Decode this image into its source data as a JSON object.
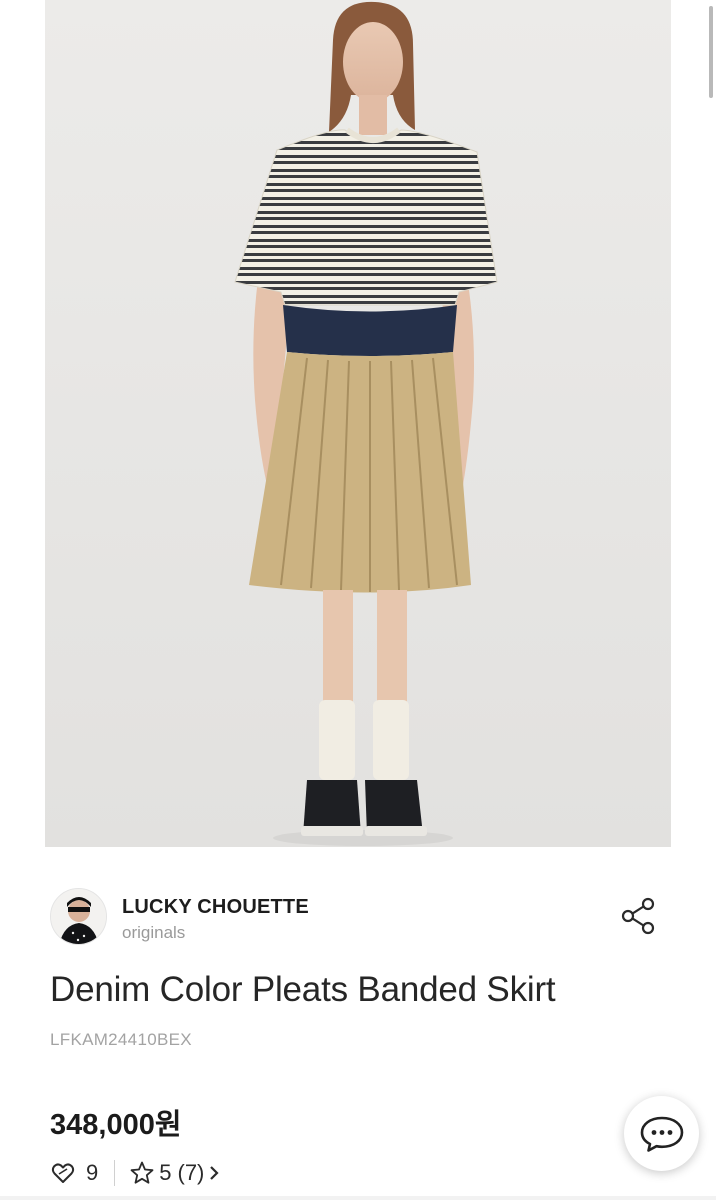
{
  "seller": {
    "name": "LUCKY CHOUETTE",
    "subtitle": "originals"
  },
  "product": {
    "title": "Denim Color Pleats Banded Skirt",
    "code": "LFKAM24410BEX",
    "price": "348,000원"
  },
  "stats": {
    "likes": "9",
    "rating": "5",
    "reviews": "(7)"
  },
  "icons": {
    "share": "share-icon",
    "heart": "heart-icon",
    "star": "star-icon",
    "chevron": "chevron-right-icon",
    "chat": "chat-bubble-icon"
  },
  "colors": {
    "text": "#1a1a1a",
    "muted": "#9a9a9a",
    "background": "#ffffff"
  }
}
